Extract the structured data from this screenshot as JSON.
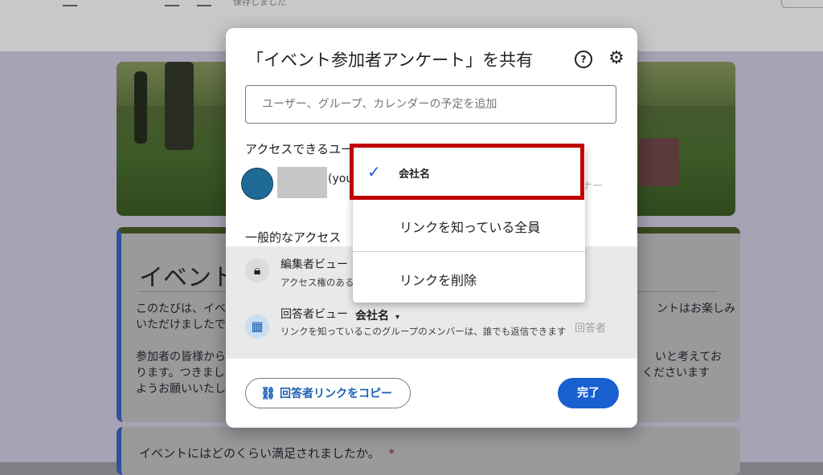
{
  "background": {
    "saved_status": "保存しました",
    "form_title": "イベント",
    "description_1a": "このたびは、イベ",
    "description_1b": "いただけましたで",
    "description_1c": "ントはお楽しみ",
    "description_2a": "参加者の皆様から",
    "description_2b": "ります。つきまし",
    "description_2c": "ようお願いいたし",
    "description_2d": "いと考えてお",
    "description_2e": "くださいます",
    "question_text": "イベントにはどのくらい満足されましたか。",
    "required_mark": "*"
  },
  "dialog": {
    "title": "「イベント参加者アンケート」を共有",
    "help_icon": "?",
    "add_placeholder": "ユーザー、グループ、カレンダーの予定を追加",
    "access_users_label": "アクセスできるユーザー",
    "owner_suffix": "(you",
    "owner_role": "ナー",
    "general_access_label": "一般的なアクセス",
    "editor_view_title": "編集者ビュー",
    "editor_view_sub": "アクセス権のある",
    "responder_view_title": "回答者ビュー",
    "responder_select": "会社名",
    "responder_caret": "▾",
    "responder_sub": "リンクを知っているこのグループのメンバーは、誰でも返信できます",
    "responder_role": "回答者",
    "copy_link_label": "回答者リンクをコピー",
    "done_label": "完了"
  },
  "menu": {
    "selected": "会社名",
    "options": [
      "リンクを知っている全員",
      "リンクを削除"
    ]
  },
  "colors": {
    "accent": "#1a5fd0",
    "highlight": "#c00000"
  }
}
